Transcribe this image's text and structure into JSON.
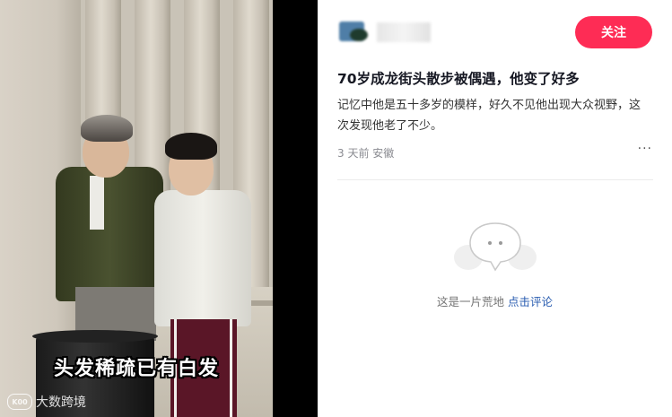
{
  "video": {
    "subtitle": "头发稀疏已有白发",
    "watermark_logo": "K00",
    "watermark_text": "大数跨境"
  },
  "post": {
    "follow_label": "关注",
    "title": "70岁成龙街头散步被偶遇，他变了好多",
    "description": "记忆中他是五十多岁的模样，好久不见他出现大众视野，这次发现他老了不少。",
    "time": "3 天前",
    "location": "安徽",
    "more_label": "···"
  },
  "comments": {
    "empty_text": "这是一片荒地",
    "action_label": "点击评论"
  },
  "colors": {
    "accent": "#fe2c55",
    "link": "#2a5db0"
  }
}
